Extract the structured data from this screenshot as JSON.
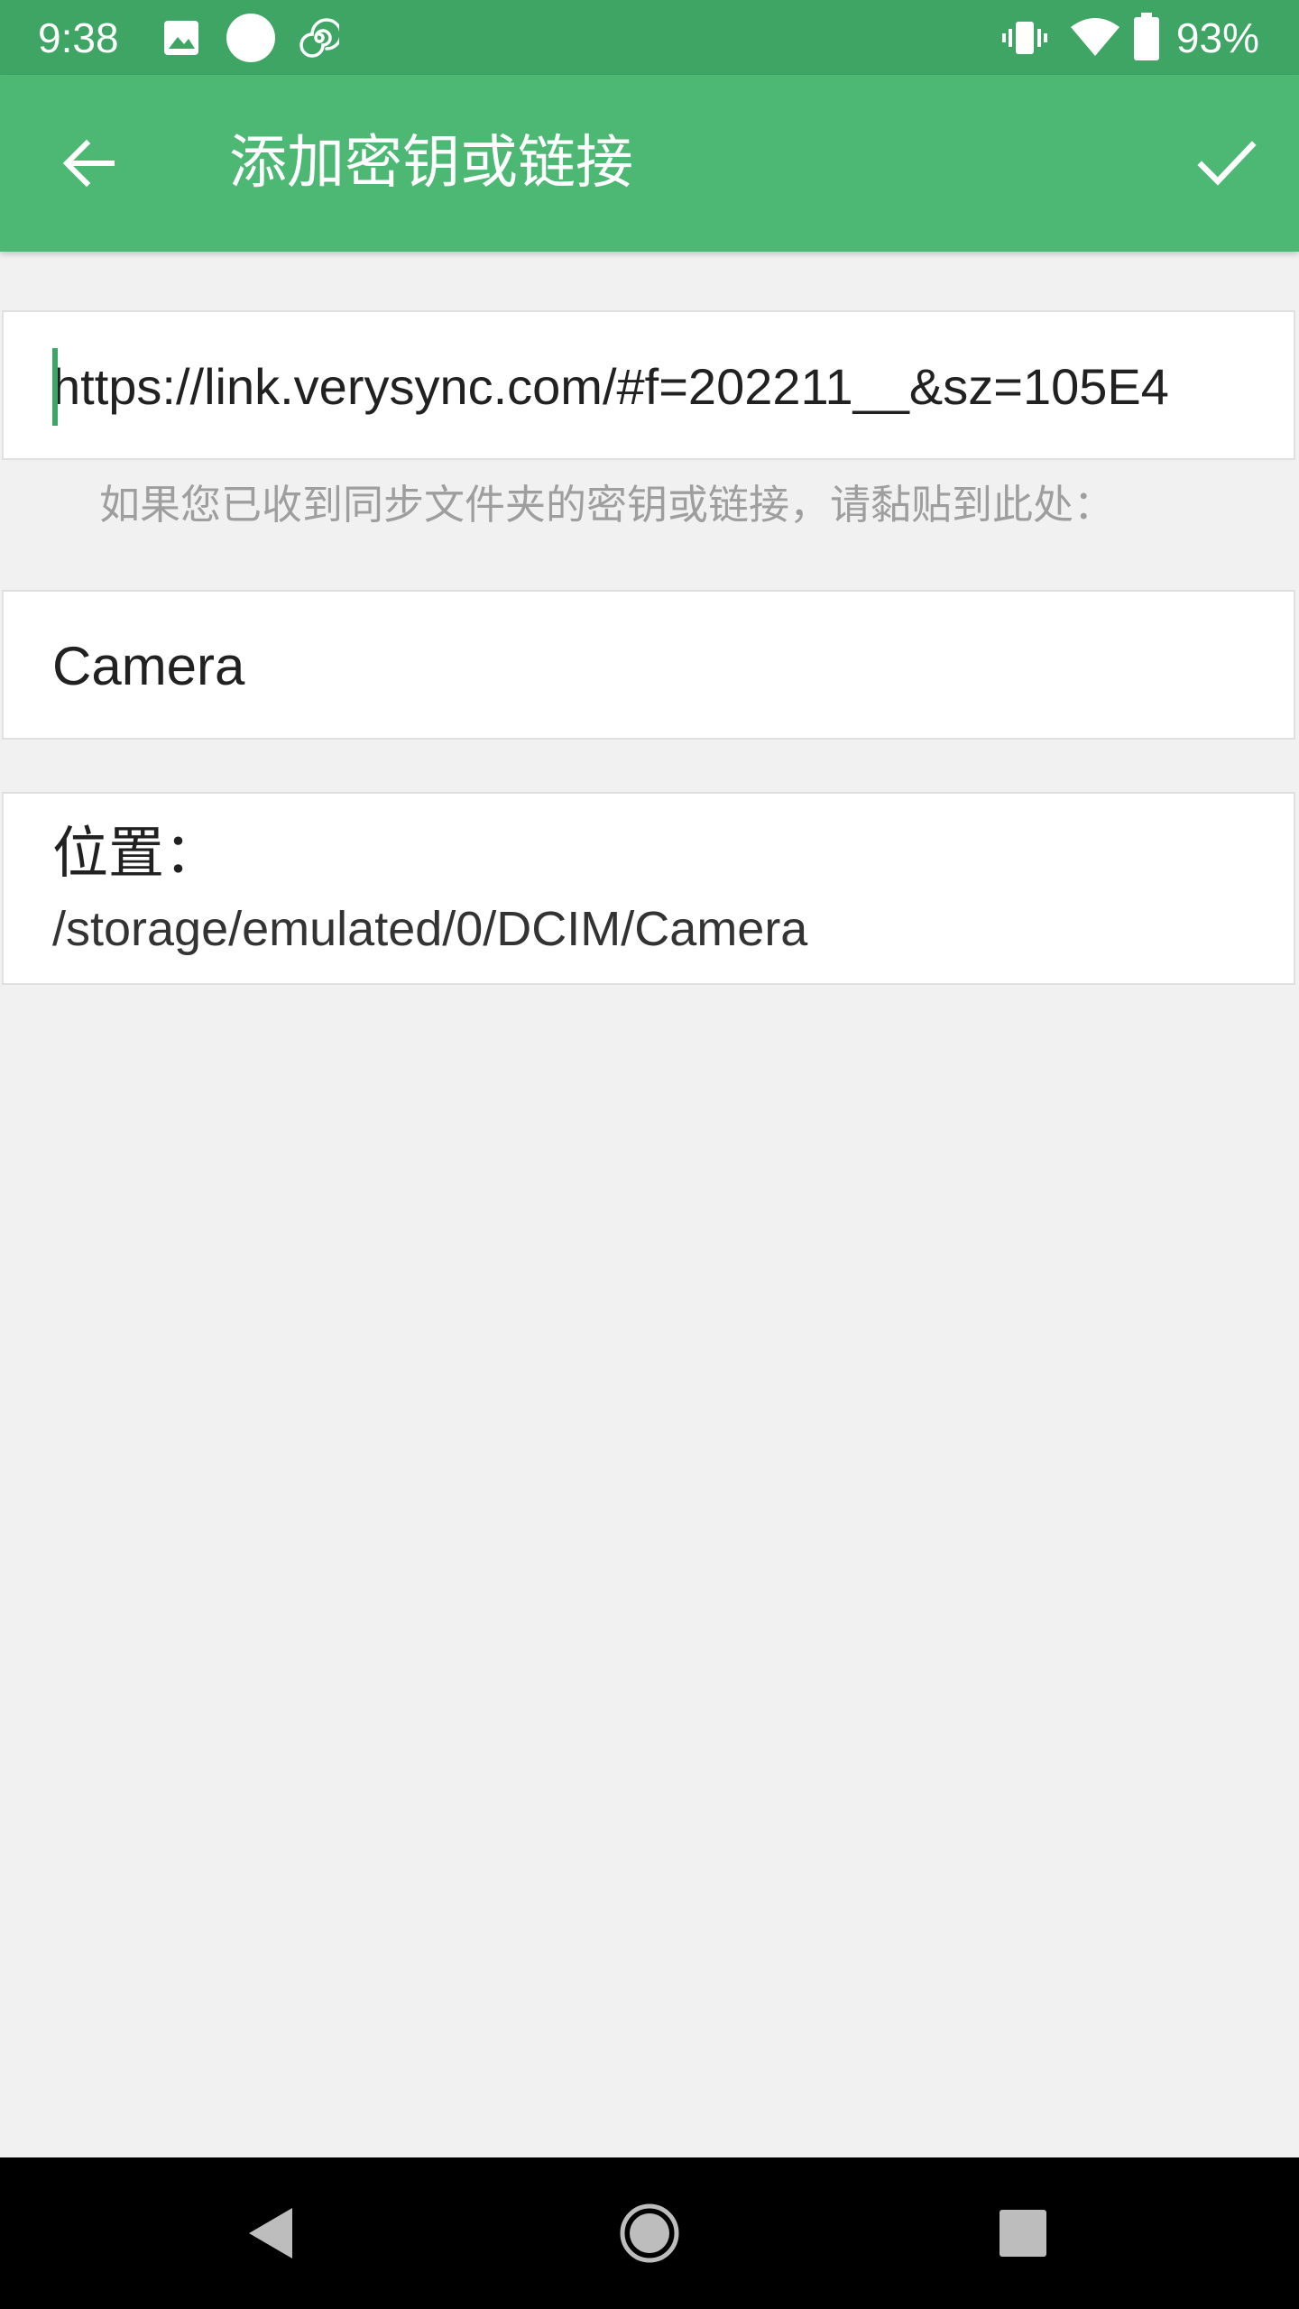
{
  "status_bar": {
    "time": "9:38",
    "battery_percent": "93%",
    "icons": [
      "image-icon",
      "circle-icon",
      "swirl-icon",
      "vibrate-icon",
      "wifi-icon",
      "battery-icon"
    ]
  },
  "app_bar": {
    "title": "添加密钥或链接",
    "back_icon": "arrow-back-icon",
    "confirm_icon": "check-icon"
  },
  "form": {
    "link_value": "https://link.verysync.com/#f=202211__&sz=105E4",
    "link_hint": "如果您已收到同步文件夹的密钥或链接，请黏贴到此处：",
    "folder_name": "Camera",
    "location_label": "位置：",
    "location_path": "/storage/emulated/0/DCIM/Camera"
  },
  "nav_bar": {
    "icons": [
      "nav-back-icon",
      "nav-home-icon",
      "nav-recents-icon"
    ]
  },
  "colors": {
    "status_bar": "#3fa565",
    "app_bar": "#4cb874",
    "background": "#f1f1f1",
    "accent": "#3fa565"
  }
}
